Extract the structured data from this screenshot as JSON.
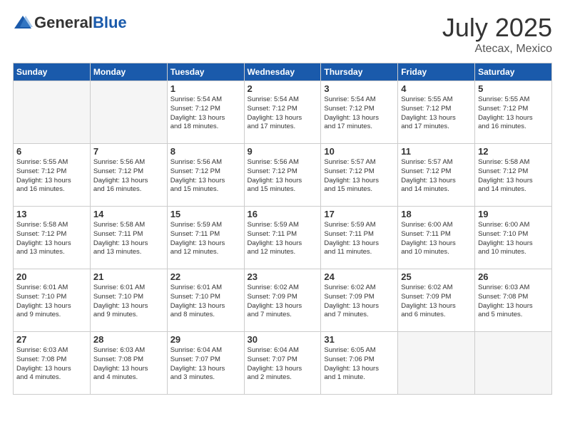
{
  "header": {
    "logo_general": "General",
    "logo_blue": "Blue",
    "month": "July 2025",
    "location": "Atecax, Mexico"
  },
  "weekdays": [
    "Sunday",
    "Monday",
    "Tuesday",
    "Wednesday",
    "Thursday",
    "Friday",
    "Saturday"
  ],
  "weeks": [
    [
      {
        "day": "",
        "info": ""
      },
      {
        "day": "",
        "info": ""
      },
      {
        "day": "1",
        "info": "Sunrise: 5:54 AM\nSunset: 7:12 PM\nDaylight: 13 hours\nand 18 minutes."
      },
      {
        "day": "2",
        "info": "Sunrise: 5:54 AM\nSunset: 7:12 PM\nDaylight: 13 hours\nand 17 minutes."
      },
      {
        "day": "3",
        "info": "Sunrise: 5:54 AM\nSunset: 7:12 PM\nDaylight: 13 hours\nand 17 minutes."
      },
      {
        "day": "4",
        "info": "Sunrise: 5:55 AM\nSunset: 7:12 PM\nDaylight: 13 hours\nand 17 minutes."
      },
      {
        "day": "5",
        "info": "Sunrise: 5:55 AM\nSunset: 7:12 PM\nDaylight: 13 hours\nand 16 minutes."
      }
    ],
    [
      {
        "day": "6",
        "info": "Sunrise: 5:55 AM\nSunset: 7:12 PM\nDaylight: 13 hours\nand 16 minutes."
      },
      {
        "day": "7",
        "info": "Sunrise: 5:56 AM\nSunset: 7:12 PM\nDaylight: 13 hours\nand 16 minutes."
      },
      {
        "day": "8",
        "info": "Sunrise: 5:56 AM\nSunset: 7:12 PM\nDaylight: 13 hours\nand 15 minutes."
      },
      {
        "day": "9",
        "info": "Sunrise: 5:56 AM\nSunset: 7:12 PM\nDaylight: 13 hours\nand 15 minutes."
      },
      {
        "day": "10",
        "info": "Sunrise: 5:57 AM\nSunset: 7:12 PM\nDaylight: 13 hours\nand 15 minutes."
      },
      {
        "day": "11",
        "info": "Sunrise: 5:57 AM\nSunset: 7:12 PM\nDaylight: 13 hours\nand 14 minutes."
      },
      {
        "day": "12",
        "info": "Sunrise: 5:58 AM\nSunset: 7:12 PM\nDaylight: 13 hours\nand 14 minutes."
      }
    ],
    [
      {
        "day": "13",
        "info": "Sunrise: 5:58 AM\nSunset: 7:12 PM\nDaylight: 13 hours\nand 13 minutes."
      },
      {
        "day": "14",
        "info": "Sunrise: 5:58 AM\nSunset: 7:11 PM\nDaylight: 13 hours\nand 13 minutes."
      },
      {
        "day": "15",
        "info": "Sunrise: 5:59 AM\nSunset: 7:11 PM\nDaylight: 13 hours\nand 12 minutes."
      },
      {
        "day": "16",
        "info": "Sunrise: 5:59 AM\nSunset: 7:11 PM\nDaylight: 13 hours\nand 12 minutes."
      },
      {
        "day": "17",
        "info": "Sunrise: 5:59 AM\nSunset: 7:11 PM\nDaylight: 13 hours\nand 11 minutes."
      },
      {
        "day": "18",
        "info": "Sunrise: 6:00 AM\nSunset: 7:11 PM\nDaylight: 13 hours\nand 10 minutes."
      },
      {
        "day": "19",
        "info": "Sunrise: 6:00 AM\nSunset: 7:10 PM\nDaylight: 13 hours\nand 10 minutes."
      }
    ],
    [
      {
        "day": "20",
        "info": "Sunrise: 6:01 AM\nSunset: 7:10 PM\nDaylight: 13 hours\nand 9 minutes."
      },
      {
        "day": "21",
        "info": "Sunrise: 6:01 AM\nSunset: 7:10 PM\nDaylight: 13 hours\nand 9 minutes."
      },
      {
        "day": "22",
        "info": "Sunrise: 6:01 AM\nSunset: 7:10 PM\nDaylight: 13 hours\nand 8 minutes."
      },
      {
        "day": "23",
        "info": "Sunrise: 6:02 AM\nSunset: 7:09 PM\nDaylight: 13 hours\nand 7 minutes."
      },
      {
        "day": "24",
        "info": "Sunrise: 6:02 AM\nSunset: 7:09 PM\nDaylight: 13 hours\nand 7 minutes."
      },
      {
        "day": "25",
        "info": "Sunrise: 6:02 AM\nSunset: 7:09 PM\nDaylight: 13 hours\nand 6 minutes."
      },
      {
        "day": "26",
        "info": "Sunrise: 6:03 AM\nSunset: 7:08 PM\nDaylight: 13 hours\nand 5 minutes."
      }
    ],
    [
      {
        "day": "27",
        "info": "Sunrise: 6:03 AM\nSunset: 7:08 PM\nDaylight: 13 hours\nand 4 minutes."
      },
      {
        "day": "28",
        "info": "Sunrise: 6:03 AM\nSunset: 7:08 PM\nDaylight: 13 hours\nand 4 minutes."
      },
      {
        "day": "29",
        "info": "Sunrise: 6:04 AM\nSunset: 7:07 PM\nDaylight: 13 hours\nand 3 minutes."
      },
      {
        "day": "30",
        "info": "Sunrise: 6:04 AM\nSunset: 7:07 PM\nDaylight: 13 hours\nand 2 minutes."
      },
      {
        "day": "31",
        "info": "Sunrise: 6:05 AM\nSunset: 7:06 PM\nDaylight: 13 hours\nand 1 minute."
      },
      {
        "day": "",
        "info": ""
      },
      {
        "day": "",
        "info": ""
      }
    ]
  ]
}
